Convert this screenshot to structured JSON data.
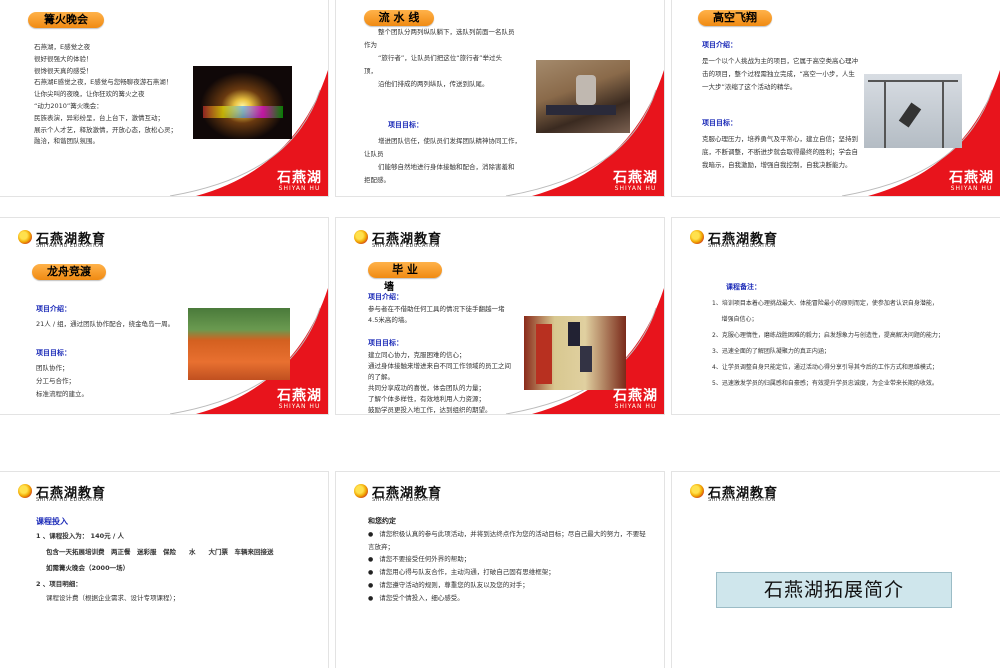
{
  "brand": {
    "zh": "石燕湖",
    "en": "SHIYAN HU",
    "logo_zh": "石燕湖教育",
    "logo_en": "SHIYAN HU EDUCATION"
  },
  "colors": {
    "accent": "#e8141c",
    "pill": "#f39a1f",
    "title_blue": "#1c2bb8"
  },
  "s1": {
    "title": "篝火晚会",
    "lines": [
      "石燕湖，E感觉之夜",
      "很好很强大的体验！",
      "很馋很天真的感受！",
      "石燕湖E感觉之夜，E感觉与您畅聊夜游石燕湖！",
      "让你尖叫的夜晚，让你狂欢的篝火之夜",
      "“动力2010”篝火晚会：",
      "民族表演，异彩纷呈，台上台下，激情互动；",
      "展示个人才艺，释放激情，开放心态，放松心灵；",
      "融洽，和谐团队氛围。"
    ],
    "photo": "bonfire-stage-photo"
  },
  "s2": {
    "title": "流 水 线",
    "lines": [
      "整个团队分两列纵队躺下，选队列前面一名队员",
      "作为",
      "“旅行者”，让队员们把这位“旅行者”举过头",
      "顶，",
      "沿他们排成的两列纵队，传送到队尾。"
    ],
    "goal_label": "项目目标：",
    "goals": [
      "增进团队信任，使队员们发挥团队精神协同工作，",
      "让队员",
      "们能够自然地进行身体接触和配合，消除害羞和",
      "拒配感。"
    ],
    "photo": "team-passing-photo"
  },
  "s3": {
    "title": "高空飞翔",
    "intro_label": "项目介绍：",
    "intro": [
      "是一个以个人挑战为主的项目，它属于高空类高心理冲",
      "击的项目，整个过程需独立完成，“高空一小步，人生",
      "一大步”浓缩了这个活动的精华。"
    ],
    "goal_label": "项目目标：",
    "goals": [
      "克服心理压力，培养勇气及平常心，建立自信；坚持到",
      "底，不断调整，不断进步就会取得最终的胜利；学会自",
      "我暗示，自我激励，增强自我控制，自我决断能力。"
    ],
    "photo": "high-altitude-jump-photo"
  },
  "s4": {
    "title": "龙舟竞渡",
    "intro_label": "项目介绍：",
    "intro": [
      "21人 / 组，通过团队协作配合，绕金龟岛一周。"
    ],
    "goal_label": "项目目标：",
    "goals": [
      "团队协作；",
      "分工与合作；",
      "标准流程的建立。"
    ],
    "photo": "dragon-boat-team-photo"
  },
  "s5": {
    "title": "毕  业",
    "title2": "墙",
    "intro_label": "项目介绍：",
    "intro": [
      "参与者在不借助任何工具的情况下徒手翻越一堵",
      "4.5米高的墙。"
    ],
    "goal_label": "项目目标：",
    "goals": [
      "建立同心协力，克服困难的信心；",
      "通过身体接触来增进来自不同工作领域的员工之间",
      "的了解。",
      "共同分享成功的喜悦，体会团队的力量；",
      "了解个体多样性，有效地利用人力资源；",
      "鼓励学员更投入地工作，达到组织的期望。"
    ],
    "photo": "graduation-wall-photo"
  },
  "s6": {
    "title": "课程备注：",
    "notes": [
      "1、培训项目本着心理挑战最大、体能冒险最小的原则而定，使参加者认识自身潜能，",
      "     增强自信心；",
      "2、克服心理惰性，磨练战胜困难的毅力；启发想象力与创造性，提高解决问题的能力；",
      "3、迅速全面的了解团队凝聚力的真正内涵；",
      "4、让学员调整自身只能定位，通过活动心得分享引导其今后的工作方式和思维模式；",
      "5、迅速激发学员的归属感和自豪感；有效提升学员忠诚度，为企业带来长期的收效。"
    ]
  },
  "s7": {
    "title": "课程投入",
    "fee": "1 、课程投入为： 140元 / 人",
    "includes": "包含一天拓展培训费　两正餐　迷彩服　保险　　水　　大门票　车辆来回接送",
    "extra": "如需篝火晚会（2000一场）",
    "detail_label": "2 、项目明细：",
    "detail": "课程设计费（根据企业需求、设计专项课程）；"
  },
  "s8": {
    "title": "和您约定",
    "items": [
      "请您积极认真的参与此项活动，并将到达终点作为您的活动目标；尽自己最大的努力，不要轻言放弃；",
      "请您不要接受任何外界的帮助；",
      "请您用心得与队友合作，主动沟通，打破自己固有思维框架；",
      "请您遵守活动的规则，尊重您的队友以及您的对手；",
      "请您受个情投入，细心感受。"
    ]
  },
  "s9": {
    "banner": "石燕湖拓展简介"
  }
}
